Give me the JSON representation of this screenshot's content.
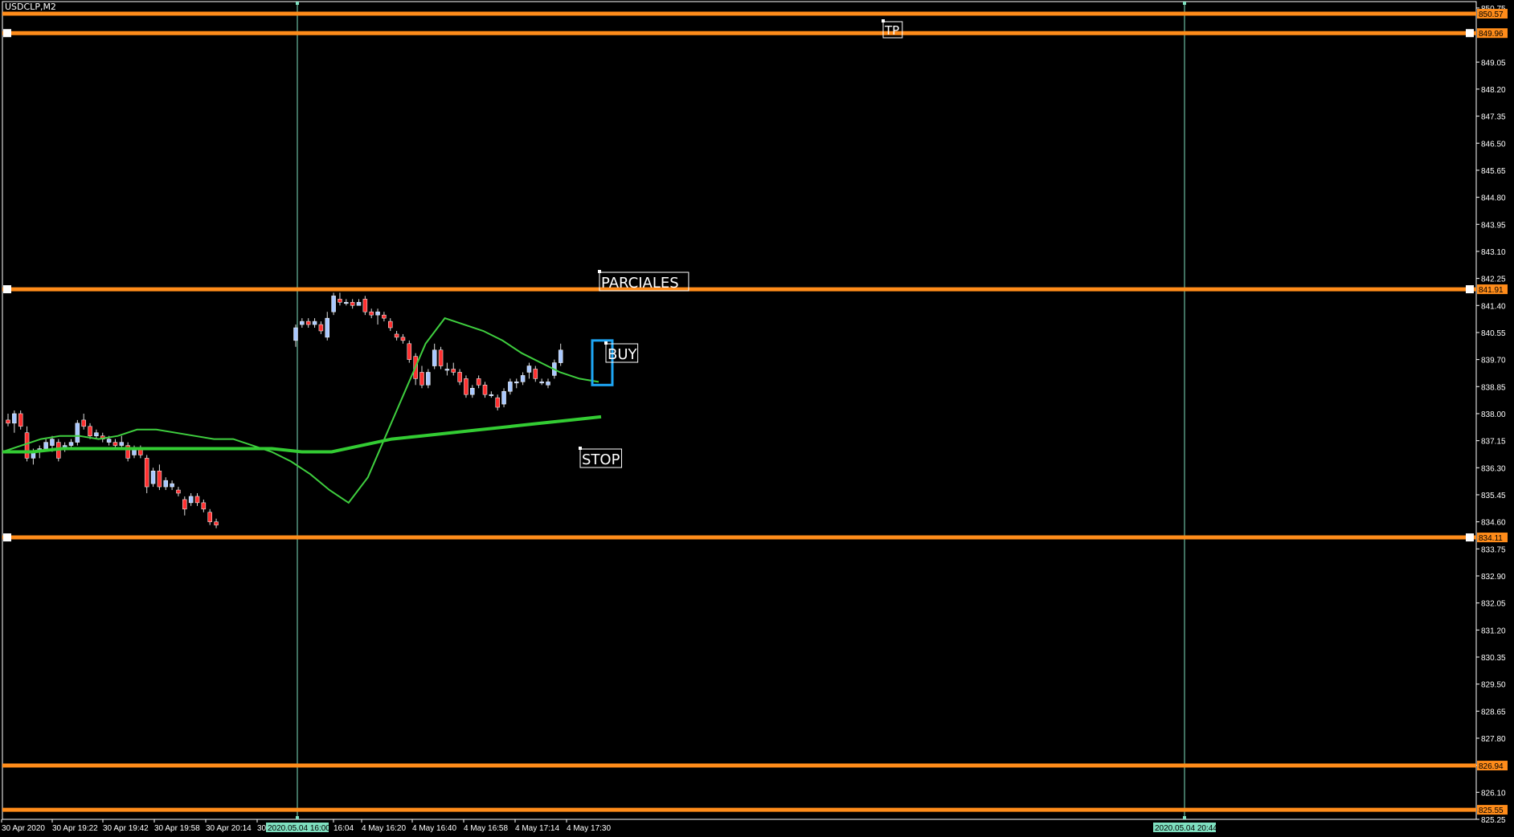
{
  "window": {
    "symbol_label": "USDCLP,M2"
  },
  "colors": {
    "background": "#000000",
    "frame": "#ffffff",
    "candle_up": "#a9c8ff",
    "candle_down": "#ff3030",
    "hline": "#ff8c1a",
    "vline": "#7fe0c0",
    "ma_fast": "#3fcf3f",
    "ma_slow": "#33cc33",
    "buy_box": "#1ea6f5",
    "axis_text": "#ffffff"
  },
  "price_axis": {
    "ticks": [
      "850.75",
      "849.05",
      "848.20",
      "847.35",
      "846.50",
      "845.65",
      "844.80",
      "843.95",
      "843.10",
      "842.25",
      "841.40",
      "840.55",
      "839.70",
      "838.85",
      "838.00",
      "837.15",
      "836.30",
      "835.45",
      "834.60",
      "833.75",
      "832.90",
      "832.05",
      "831.20",
      "830.35",
      "829.50",
      "828.65",
      "827.80",
      "826.95",
      "826.10",
      "825.25"
    ]
  },
  "time_axis": {
    "labels": [
      "30 Apr 2020",
      "30 Apr 19:22",
      "30 Apr 19:42",
      "30 Apr 19:58",
      "30 Apr 20:14",
      "30",
      "16:04",
      "4 May 16:20",
      "4 May 16:40",
      "4 May 16:58",
      "4 May 17:14",
      "4 May 17:30"
    ]
  },
  "hlines": [
    {
      "name": "hline-1",
      "price": 850.57,
      "label": "850.57"
    },
    {
      "name": "hline-2",
      "price": 849.96,
      "label": "849.96"
    },
    {
      "name": "hline-parciales",
      "price": 841.91,
      "label": "841.91"
    },
    {
      "name": "hline-stop",
      "price": 834.11,
      "label": "834.11"
    },
    {
      "name": "hline-5",
      "price": 826.94,
      "label": "826.94"
    },
    {
      "name": "hline-6",
      "price": 825.55,
      "label": "825.55"
    }
  ],
  "vlines": [
    {
      "name": "vline-start",
      "label": "2020.05.04 16:00"
    },
    {
      "name": "vline-end",
      "label": "2020.05.04 20:44"
    }
  ],
  "text_labels": {
    "tp": "TP",
    "parciales": "PARCIALES",
    "buy": "BUY",
    "stop": "STOP"
  },
  "chart_data": {
    "type": "candlestick",
    "symbol": "USDCLP",
    "timeframe": "M2",
    "candles": [
      {
        "o": 837.8,
        "h": 838.0,
        "l": 837.6,
        "c": 837.7
      },
      {
        "o": 837.7,
        "h": 838.1,
        "l": 837.4,
        "c": 838.0
      },
      {
        "o": 838.0,
        "h": 838.1,
        "l": 837.5,
        "c": 837.6
      },
      {
        "o": 837.4,
        "h": 837.6,
        "l": 836.5,
        "c": 836.6
      },
      {
        "o": 836.6,
        "h": 836.9,
        "l": 836.4,
        "c": 836.8
      },
      {
        "o": 836.8,
        "h": 837.0,
        "l": 836.6,
        "c": 836.9
      },
      {
        "o": 836.9,
        "h": 837.2,
        "l": 836.8,
        "c": 837.1
      },
      {
        "o": 837.0,
        "h": 837.3,
        "l": 836.8,
        "c": 837.2
      },
      {
        "o": 837.1,
        "h": 837.2,
        "l": 836.5,
        "c": 836.6
      },
      {
        "o": 836.9,
        "h": 837.1,
        "l": 836.8,
        "c": 837.0
      },
      {
        "o": 837.0,
        "h": 837.2,
        "l": 836.9,
        "c": 837.1
      },
      {
        "o": 837.1,
        "h": 837.8,
        "l": 837.0,
        "c": 837.7
      },
      {
        "o": 837.8,
        "h": 838.0,
        "l": 837.5,
        "c": 837.6
      },
      {
        "o": 837.6,
        "h": 837.7,
        "l": 837.2,
        "c": 837.3
      },
      {
        "o": 837.3,
        "h": 837.5,
        "l": 837.2,
        "c": 837.4
      },
      {
        "o": 837.3,
        "h": 837.4,
        "l": 837.1,
        "c": 837.2
      },
      {
        "o": 837.1,
        "h": 837.3,
        "l": 837.0,
        "c": 837.2
      },
      {
        "o": 837.1,
        "h": 837.2,
        "l": 836.9,
        "c": 837.0
      },
      {
        "o": 837.0,
        "h": 837.3,
        "l": 836.9,
        "c": 837.1
      },
      {
        "o": 837.0,
        "h": 837.1,
        "l": 836.5,
        "c": 836.6
      },
      {
        "o": 836.7,
        "h": 837.0,
        "l": 836.6,
        "c": 836.9
      },
      {
        "o": 836.9,
        "h": 837.0,
        "l": 836.6,
        "c": 836.7
      },
      {
        "o": 836.6,
        "h": 836.7,
        "l": 835.5,
        "c": 835.7
      },
      {
        "o": 835.8,
        "h": 836.3,
        "l": 835.7,
        "c": 836.2
      },
      {
        "o": 836.2,
        "h": 836.4,
        "l": 835.6,
        "c": 835.7
      },
      {
        "o": 835.7,
        "h": 836.0,
        "l": 835.6,
        "c": 835.9
      },
      {
        "o": 835.7,
        "h": 835.9,
        "l": 835.6,
        "c": 835.8
      },
      {
        "o": 835.6,
        "h": 835.7,
        "l": 835.4,
        "c": 835.5
      },
      {
        "o": 835.3,
        "h": 835.4,
        "l": 834.8,
        "c": 835.0
      },
      {
        "o": 835.2,
        "h": 835.5,
        "l": 835.1,
        "c": 835.4
      },
      {
        "o": 835.4,
        "h": 835.5,
        "l": 835.1,
        "c": 835.2
      },
      {
        "o": 835.2,
        "h": 835.3,
        "l": 834.9,
        "c": 835.0
      },
      {
        "o": 834.9,
        "h": 835.0,
        "l": 834.5,
        "c": 834.6
      },
      {
        "o": 834.6,
        "h": 834.7,
        "l": 834.4,
        "c": 834.5
      },
      {
        "o": 840.3,
        "h": 840.8,
        "l": 840.1,
        "c": 840.7
      },
      {
        "o": 840.8,
        "h": 841.0,
        "l": 840.7,
        "c": 840.9
      },
      {
        "o": 840.9,
        "h": 841.0,
        "l": 840.7,
        "c": 840.8
      },
      {
        "o": 840.8,
        "h": 841.0,
        "l": 840.7,
        "c": 840.9
      },
      {
        "o": 840.8,
        "h": 840.9,
        "l": 840.5,
        "c": 840.6
      },
      {
        "o": 840.4,
        "h": 841.2,
        "l": 840.3,
        "c": 841.0
      },
      {
        "o": 841.2,
        "h": 841.8,
        "l": 841.1,
        "c": 841.7
      },
      {
        "o": 841.6,
        "h": 841.8,
        "l": 841.4,
        "c": 841.5
      },
      {
        "o": 841.5,
        "h": 841.6,
        "l": 841.4,
        "c": 841.5
      },
      {
        "o": 841.5,
        "h": 841.6,
        "l": 841.3,
        "c": 841.4
      },
      {
        "o": 841.4,
        "h": 841.6,
        "l": 841.4,
        "c": 841.5
      },
      {
        "o": 841.6,
        "h": 841.7,
        "l": 841.1,
        "c": 841.2
      },
      {
        "o": 841.2,
        "h": 841.3,
        "l": 841.0,
        "c": 841.1
      },
      {
        "o": 841.1,
        "h": 841.3,
        "l": 840.8,
        "c": 841.2
      },
      {
        "o": 841.1,
        "h": 841.2,
        "l": 840.9,
        "c": 841.0
      },
      {
        "o": 840.9,
        "h": 841.0,
        "l": 840.6,
        "c": 840.7
      },
      {
        "o": 840.5,
        "h": 840.6,
        "l": 840.3,
        "c": 840.4
      },
      {
        "o": 840.4,
        "h": 840.5,
        "l": 840.2,
        "c": 840.3
      },
      {
        "o": 840.2,
        "h": 840.3,
        "l": 839.6,
        "c": 839.7
      },
      {
        "o": 839.8,
        "h": 839.9,
        "l": 838.9,
        "c": 839.1
      },
      {
        "o": 839.3,
        "h": 839.5,
        "l": 838.8,
        "c": 838.9
      },
      {
        "o": 838.9,
        "h": 839.4,
        "l": 838.8,
        "c": 839.3
      },
      {
        "o": 839.5,
        "h": 840.2,
        "l": 839.4,
        "c": 840.0
      },
      {
        "o": 840.0,
        "h": 840.1,
        "l": 839.4,
        "c": 839.5
      },
      {
        "o": 839.4,
        "h": 839.6,
        "l": 839.2,
        "c": 839.4
      },
      {
        "o": 839.4,
        "h": 839.6,
        "l": 839.2,
        "c": 839.3
      },
      {
        "o": 839.3,
        "h": 839.4,
        "l": 838.9,
        "c": 839.0
      },
      {
        "o": 839.1,
        "h": 839.2,
        "l": 838.5,
        "c": 838.6
      },
      {
        "o": 838.6,
        "h": 838.9,
        "l": 838.5,
        "c": 838.8
      },
      {
        "o": 839.1,
        "h": 839.2,
        "l": 838.8,
        "c": 838.9
      },
      {
        "o": 838.9,
        "h": 839.0,
        "l": 838.5,
        "c": 838.6
      },
      {
        "o": 838.6,
        "h": 838.7,
        "l": 838.5,
        "c": 838.6
      },
      {
        "o": 838.5,
        "h": 838.6,
        "l": 838.1,
        "c": 838.2
      },
      {
        "o": 838.3,
        "h": 838.8,
        "l": 838.2,
        "c": 838.7
      },
      {
        "o": 838.7,
        "h": 839.1,
        "l": 838.6,
        "c": 839.0
      },
      {
        "o": 839.0,
        "h": 839.1,
        "l": 838.8,
        "c": 839.0
      },
      {
        "o": 839.0,
        "h": 839.3,
        "l": 838.9,
        "c": 839.2
      },
      {
        "o": 839.3,
        "h": 839.6,
        "l": 839.1,
        "c": 839.5
      },
      {
        "o": 839.4,
        "h": 839.5,
        "l": 839.0,
        "c": 839.1
      },
      {
        "o": 839.0,
        "h": 839.1,
        "l": 838.9,
        "c": 839.0
      },
      {
        "o": 838.9,
        "h": 839.1,
        "l": 838.8,
        "c": 839.0
      },
      {
        "o": 839.2,
        "h": 839.7,
        "l": 839.1,
        "c": 839.6
      },
      {
        "o": 839.6,
        "h": 840.2,
        "l": 839.5,
        "c": 840.0
      }
    ],
    "ma_fast": [
      836.8,
      837.0,
      837.2,
      837.3,
      837.3,
      837.2,
      837.3,
      837.5,
      837.5,
      837.4,
      837.3,
      837.2,
      837.2,
      837.0,
      836.8,
      836.5,
      836.1,
      835.6,
      835.2,
      836.0,
      837.4,
      838.8,
      840.2,
      841.0,
      840.8,
      840.6,
      840.3,
      839.9,
      839.6,
      839.3,
      839.1,
      839.0
    ],
    "ma_slow": [
      836.8,
      836.8,
      836.9,
      836.9,
      836.9,
      836.9,
      836.9,
      836.9,
      836.9,
      836.9,
      836.8,
      836.8,
      837.0,
      837.2,
      837.3,
      837.4,
      837.5,
      837.6,
      837.7,
      837.8,
      837.9
    ],
    "ylim": [
      825.25,
      850.95
    ]
  }
}
